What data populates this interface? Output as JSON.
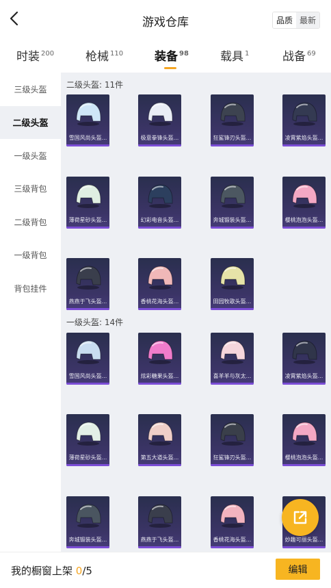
{
  "header": {
    "title": "游戏仓库",
    "sort_quality": "品质",
    "sort_latest": "最新"
  },
  "tabs": [
    {
      "label": "时装",
      "count": "200"
    },
    {
      "label": "枪械",
      "count": "110"
    },
    {
      "label": "装备",
      "count": "98"
    },
    {
      "label": "载具",
      "count": "1"
    },
    {
      "label": "战备",
      "count": "69"
    }
  ],
  "sidebar": {
    "items": [
      {
        "label": "三级头盔"
      },
      {
        "label": "二级头盔"
      },
      {
        "label": "一级头盔"
      },
      {
        "label": "三级背包"
      },
      {
        "label": "二级背包"
      },
      {
        "label": "一级背包"
      },
      {
        "label": "背包挂件"
      }
    ]
  },
  "sections": [
    {
      "title": "二级头盔: 11件",
      "items": [
        {
          "name": "雪国风尚头盔...",
          "icon": "helmet-icon",
          "color": "#cfe6f7"
        },
        {
          "name": "极意拳锋头盔...",
          "icon": "helmet-icon",
          "color": "#e9edf5"
        },
        {
          "name": "狂鲨锋刃头盔...",
          "icon": "helmet-icon",
          "color": "#3d4350"
        },
        {
          "name": "凌霄紫焰头盔...",
          "icon": "helmet-icon",
          "color": "#343a52"
        },
        {
          "name": "薄荷星砂头盔...",
          "icon": "helmet-icon",
          "color": "#dfeee2"
        },
        {
          "name": "幻彩电音头盔...",
          "icon": "helmet-icon",
          "color": "#2c3f5e"
        },
        {
          "name": "奔城锻装头盔...",
          "icon": "helmet-icon",
          "color": "#4c5761"
        },
        {
          "name": "樱桃泡泡头盔...",
          "icon": "helmet-icon",
          "color": "#f3a8c4"
        },
        {
          "name": "燕燕于飞头盔...",
          "icon": "helmet-icon",
          "color": "#3a3e4c"
        },
        {
          "name": "香桃花海头盔...",
          "icon": "helmet-icon",
          "color": "#f0b8b8"
        },
        {
          "name": "田园牧歌头盔...",
          "icon": "helmet-icon",
          "color": "#e6e3a8"
        }
      ]
    },
    {
      "title": "一级头盔: 14件",
      "items": [
        {
          "name": "雪国风尚头盔...",
          "icon": "helmet-icon",
          "color": "#c9ddf0"
        },
        {
          "name": "炫彩糖果头盔...",
          "icon": "helmet-icon",
          "color": "#f07ccb"
        },
        {
          "name": "喜羊羊与灰太...",
          "icon": "helmet-icon",
          "color": "#f6d6dc"
        },
        {
          "name": "凌霄紫焰头盔...",
          "icon": "helmet-icon",
          "color": "#30354a"
        },
        {
          "name": "薄荷星砂头盔...",
          "icon": "helmet-icon",
          "color": "#e3efe6"
        },
        {
          "name": "第五大道头盔...",
          "icon": "helmet-icon",
          "color": "#f0cfc8"
        },
        {
          "name": "狂鲨锋刃头盔...",
          "icon": "helmet-icon",
          "color": "#3a3f4a"
        },
        {
          "name": "樱桃泡泡头盔...",
          "icon": "helmet-icon",
          "color": "#f3a8c4"
        },
        {
          "name": "奔城锻装头盔...",
          "icon": "helmet-icon",
          "color": "#4a5560"
        },
        {
          "name": "燕燕于飞头盔...",
          "icon": "helmet-icon",
          "color": "#3a3e4c"
        },
        {
          "name": "香桃花海头盔...",
          "icon": "helmet-icon",
          "color": "#f2b3bf"
        },
        {
          "name": "妙趣可丽头盔...",
          "icon": "helmet-icon",
          "color": "#f6d9a8"
        }
      ]
    }
  ],
  "bottom": {
    "label": "我的橱窗上架 ",
    "count": "0",
    "total": "/5",
    "edit_label": "编辑"
  },
  "fab_icon": "share-icon",
  "colors": {
    "accent": "#f7b521",
    "card_bar": "#7b4dd6"
  }
}
